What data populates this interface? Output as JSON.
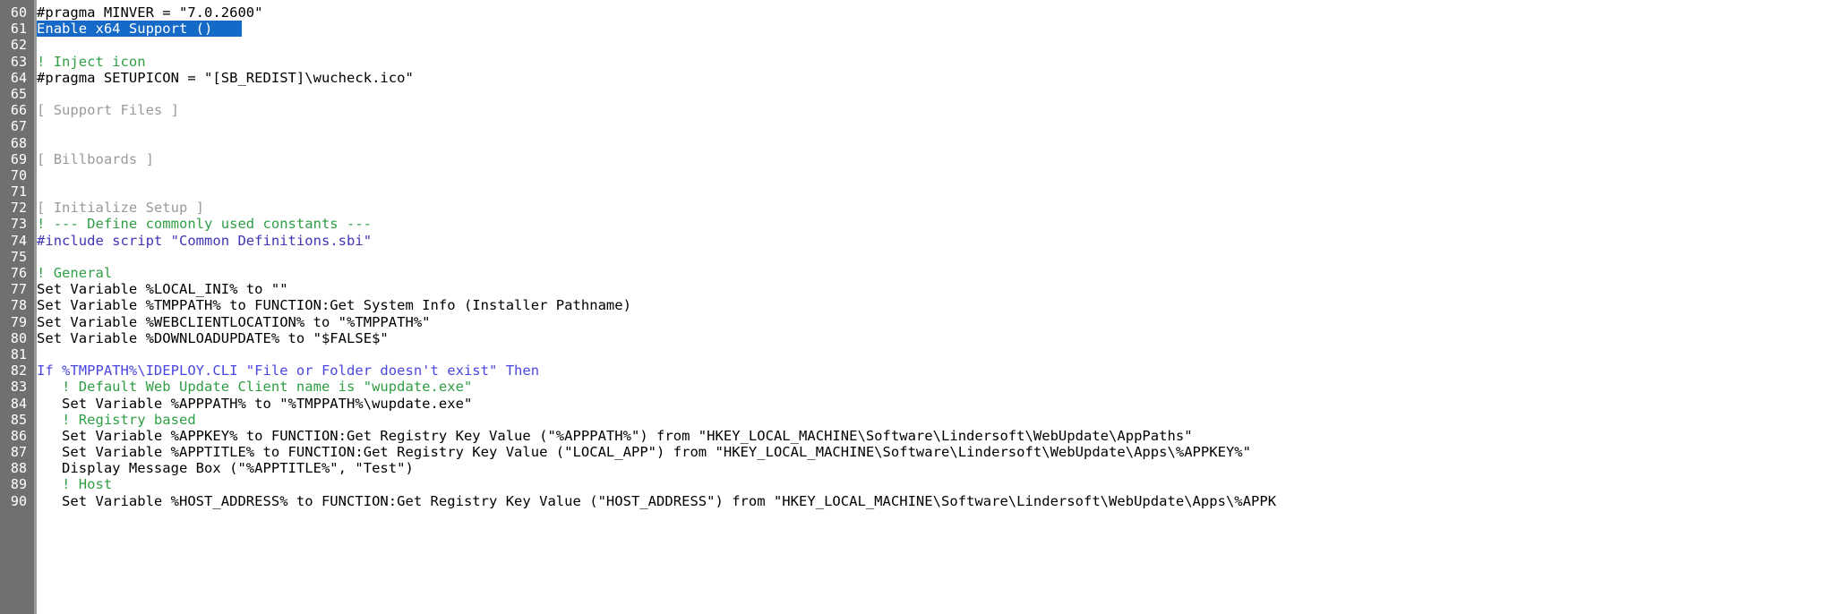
{
  "editor": {
    "name": "script-code-editor",
    "language": "SetupBuilder script",
    "first_visible_line": 60,
    "last_visible_line": 89,
    "selected_line": 61,
    "colors": {
      "gutter_background": "#707070",
      "gutter_text": "#ffffff",
      "editor_background": "#ffffff",
      "selection_background": "#1569c7",
      "selection_text": "#ffffff",
      "plain_text": "#000000",
      "comment": "#2f9e44",
      "section_header": "#9a9a9a",
      "include_directive": "#4035b5",
      "keyword": "#4a46e0"
    }
  },
  "lines": [
    {
      "number": "60",
      "text": "#pragma MINVER = \"7.0.2600\"",
      "style": "plain",
      "selected": false
    },
    {
      "number": "61",
      "text": "Enable x64 Support ()",
      "style": "plain",
      "selected": true,
      "selection_width": 229
    },
    {
      "number": "62",
      "text": "",
      "style": "plain",
      "selected": false
    },
    {
      "number": "63",
      "text": "! Inject icon",
      "style": "comment",
      "selected": false
    },
    {
      "number": "64",
      "text": "#pragma SETUPICON = \"[SB_REDIST]\\wucheck.ico\"",
      "style": "plain",
      "selected": false
    },
    {
      "number": "65",
      "text": "",
      "style": "plain",
      "selected": false
    },
    {
      "number": "66",
      "text": "[ Support Files ]",
      "style": "section",
      "selected": false
    },
    {
      "number": "67",
      "text": "",
      "style": "plain",
      "selected": false
    },
    {
      "number": "68",
      "text": "",
      "style": "plain",
      "selected": false
    },
    {
      "number": "69",
      "text": "[ Billboards ]",
      "style": "section",
      "selected": false
    },
    {
      "number": "70",
      "text": "",
      "style": "plain",
      "selected": false
    },
    {
      "number": "71",
      "text": "",
      "style": "plain",
      "selected": false
    },
    {
      "number": "72",
      "text": "[ Initialize Setup ]",
      "style": "section",
      "selected": false
    },
    {
      "number": "73",
      "text": "! --- Define commonly used constants ---",
      "style": "comment",
      "selected": false
    },
    {
      "number": "74",
      "text": "#include script \"Common Definitions.sbi\"",
      "style": "include",
      "selected": false
    },
    {
      "number": "75",
      "text": "",
      "style": "plain",
      "selected": false
    },
    {
      "number": "76",
      "text": "! General",
      "style": "comment",
      "selected": false
    },
    {
      "number": "77",
      "text": "Set Variable %LOCAL_INI% to \"\"",
      "style": "plain",
      "selected": false
    },
    {
      "number": "78",
      "text": "Set Variable %TMPPATH% to FUNCTION:Get System Info (Installer Pathname)",
      "style": "plain",
      "selected": false
    },
    {
      "number": "79",
      "text": "Set Variable %WEBCLIENTLOCATION% to \"%TMPPATH%\"",
      "style": "plain",
      "selected": false
    },
    {
      "number": "80",
      "text": "Set Variable %DOWNLOADUPDATE% to \"$FALSE$\"",
      "style": "plain",
      "selected": false
    },
    {
      "number": "81",
      "text": "",
      "style": "plain",
      "selected": false
    },
    {
      "number": "82",
      "text": "If %TMPPATH%\\IDEPLOY.CLI \"File or Folder doesn't exist\" Then",
      "style": "keyword",
      "selected": false
    },
    {
      "number": "83",
      "text": "   ! Default Web Update Client name is \"wupdate.exe\"",
      "style": "comment",
      "selected": false
    },
    {
      "number": "84",
      "text": "   Set Variable %APPPATH% to \"%TMPPATH%\\wupdate.exe\"",
      "style": "plain",
      "selected": false
    },
    {
      "number": "85",
      "text": "   ! Registry based",
      "style": "comment",
      "selected": false
    },
    {
      "number": "86",
      "text": "   Set Variable %APPKEY% to FUNCTION:Get Registry Key Value (\"%APPPATH%\") from \"HKEY_LOCAL_MACHINE\\Software\\Lindersoft\\WebUpdate\\AppPaths\"",
      "style": "plain",
      "selected": false
    },
    {
      "number": "87",
      "text": "   Set Variable %APPTITLE% to FUNCTION:Get Registry Key Value (\"LOCAL_APP\") from \"HKEY_LOCAL_MACHINE\\Software\\Lindersoft\\WebUpdate\\Apps\\%APPKEY%\"",
      "style": "plain",
      "selected": false
    },
    {
      "number": "88",
      "text": "   Display Message Box (\"%APPTITLE%\", \"Test\")",
      "style": "plain",
      "selected": false
    },
    {
      "number": "89",
      "text": "   ! Host",
      "style": "comment",
      "selected": false
    },
    {
      "number": "90",
      "text": "   Set Variable %HOST_ADDRESS% to FUNCTION:Get Registry Key Value (\"HOST_ADDRESS\") from \"HKEY_LOCAL_MACHINE\\Software\\Lindersoft\\WebUpdate\\Apps\\%APPK",
      "style": "plain",
      "selected": false,
      "clipped": true
    }
  ]
}
